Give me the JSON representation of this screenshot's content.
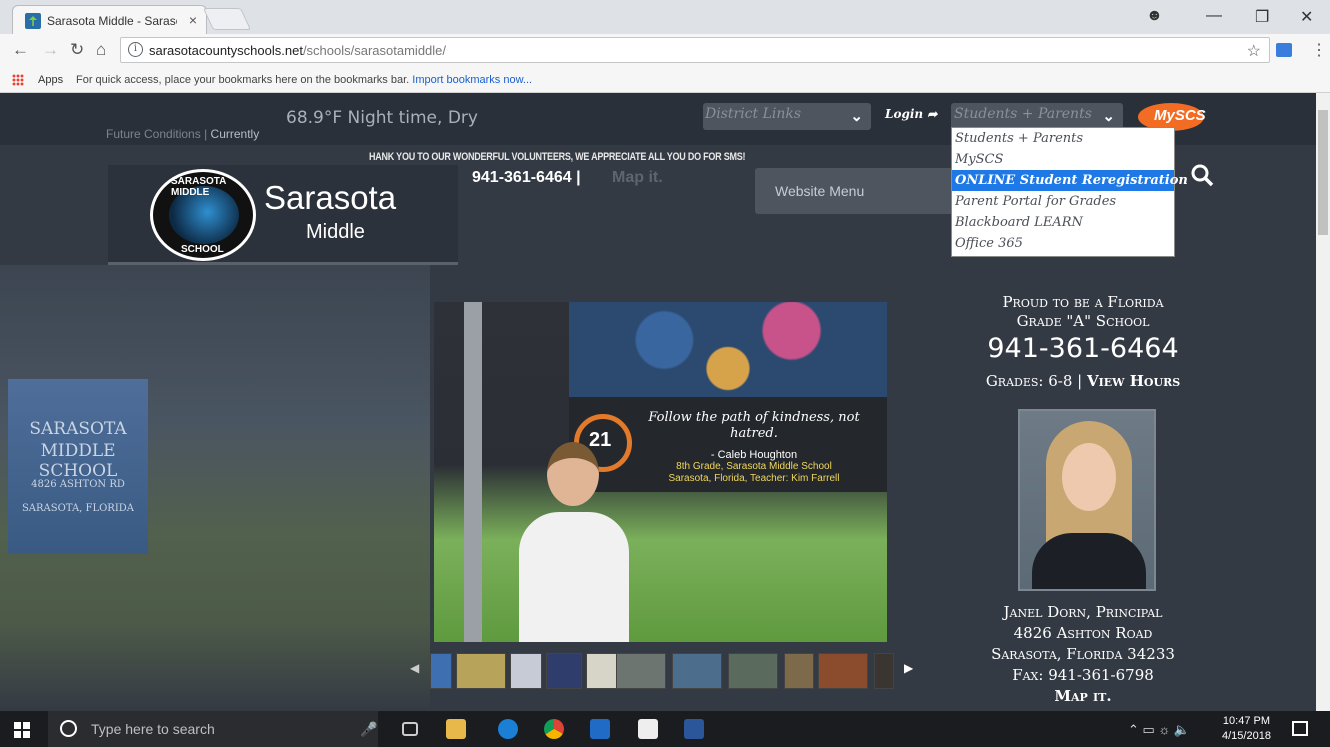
{
  "browser": {
    "tab_title": "Sarasota Middle - Saraso",
    "tab_close": "×",
    "url_host": "sarasotacountyschools.net",
    "url_path": "/schools/sarasotamiddle/",
    "apps_label": "Apps",
    "bookmarks_hint": "For quick access, place your bookmarks here on the bookmarks bar.",
    "import_link": "Import bookmarks now..."
  },
  "site": {
    "weather": "68.9°F Night time, Dry",
    "future_conditions": "Future Conditions",
    "separator": "|",
    "currently": "Currently",
    "district_links": "District Links",
    "login": "Login",
    "students_parents": "Students + Parents",
    "myscs": "MySCS",
    "ticker": "HANK YOU TO OUR WONDERFUL VOLUNTEERS, WE APPRECIATE ALL YOU DO FOR SMS!",
    "seal_top": "SARASOTA MIDDLE",
    "seal_bottom": "SCHOOL",
    "school_name": "Sarasota",
    "school_sub": "Middle",
    "phone_top": "941-361-6464 |",
    "map_it_top": "Map it.",
    "website_menu": "Website Menu",
    "dropdown_items": [
      "Students + Parents",
      "MySCS",
      "ONLINE Student Reregistration",
      "Parent Portal for Grades",
      "Blackboard LEARN",
      "Office 365"
    ],
    "dropdown_selected": 2
  },
  "hero": {
    "sign_line1": "SARASOTA",
    "sign_line2": "MIDDLE SCHOOL",
    "sign_line3": "4826 ASHTON RD",
    "sign_line4": "SARASOTA, FLORIDA",
    "quote": "Follow the path of kindness, not hatred.",
    "quote_author": "- Caleb Houghton",
    "quote_grade": "8th Grade, Sarasota Middle School",
    "quote_loc": "Sarasota, Florida, Teacher: Kim Farrell",
    "badge_number": "21"
  },
  "info": {
    "proud_line1": "Proud to be a Florida",
    "proud_line2": "Grade \"A\" School",
    "phone": "941-361-6464",
    "grades": "Grades: 6-8 |",
    "view_hours": "View Hours",
    "principal": "Janel Dorn, Principal",
    "street": "4826 Ashton Road",
    "city": "Sarasota, Florida 34233",
    "fax": "Fax: 941-361-6798",
    "map_it": "Map it."
  },
  "taskbar": {
    "search_placeholder": "Type here to search",
    "time": "10:47 PM",
    "date": "4/15/2018"
  },
  "colors": {
    "page_bg": "#343a44",
    "topbar_bg": "#2a3039",
    "dropdown_highlight": "#1e78e6",
    "myscs_orange": "#f26c23"
  }
}
